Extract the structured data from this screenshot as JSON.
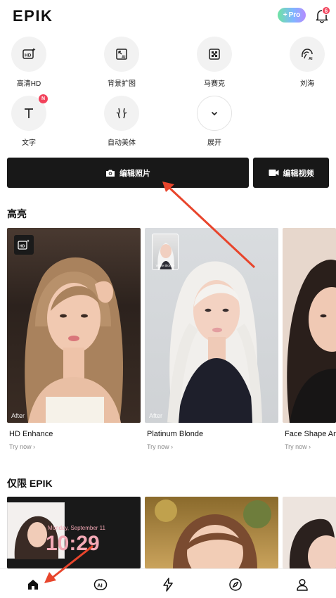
{
  "app": {
    "logo": "EPIK"
  },
  "header": {
    "pro_label": "Pro",
    "notification_count": "6"
  },
  "tools": [
    {
      "label": "高清HD",
      "icon": "hd-sparkle-icon"
    },
    {
      "label": "背景扩图",
      "icon": "expand-ai-icon"
    },
    {
      "label": "马赛克",
      "icon": "mosaic-icon"
    },
    {
      "label": "刘海",
      "icon": "bangs-ai-icon"
    },
    {
      "label": "文字",
      "icon": "text-icon",
      "badge": "N"
    },
    {
      "label": "自动美体",
      "icon": "body-shape-icon"
    },
    {
      "label": "展开",
      "icon": "chevron-down-icon"
    }
  ],
  "actions": {
    "edit_photo": "编辑照片",
    "edit_video": "编辑视频"
  },
  "highlights": {
    "title": "高亮",
    "cards": [
      {
        "title": "HD Enhance",
        "cta": "Try now ›",
        "tag": "After"
      },
      {
        "title": "Platinum Blonde",
        "cta": "Try now ›",
        "tag": "After",
        "thumb_label": "White Blonde"
      },
      {
        "title": "Face Shape An",
        "cta": "Try now ›"
      }
    ]
  },
  "epik_only": {
    "title": "仅限 EPIK",
    "lock_date": "Monday, September 11",
    "lock_time": "10:29"
  },
  "nav": [
    "home-icon",
    "ai-icon",
    "lightning-icon",
    "compass-icon",
    "profile-icon"
  ],
  "colors": {
    "accent_red": "#e8452c",
    "button_dark": "#181818",
    "badge_red": "#f2425b"
  }
}
